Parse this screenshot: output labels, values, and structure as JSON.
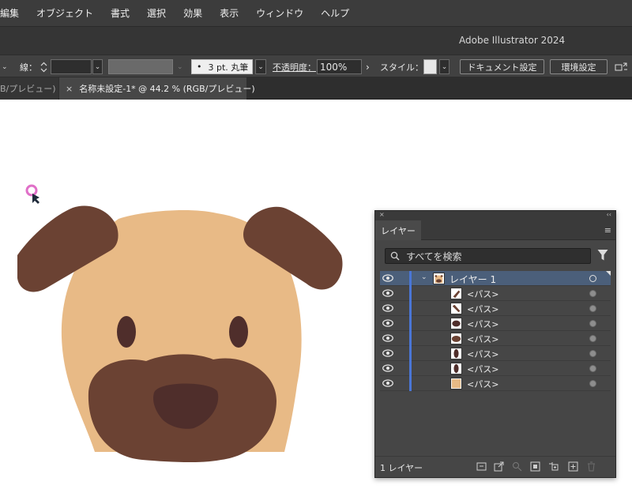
{
  "menubar": {
    "items": [
      "編集",
      "オブジェクト",
      "書式",
      "選択",
      "効果",
      "表示",
      "ウィンドウ",
      "ヘルプ"
    ]
  },
  "titlebar": {
    "title": "Adobe Illustrator 2024"
  },
  "controlbar": {
    "stroke_label": "線：",
    "brush_value": "3 pt. 丸筆",
    "brush_bullet": "•",
    "opacity_label": "不透明度：",
    "opacity_value": "100%",
    "style_label": "スタイル：",
    "doc_settings_button": "ドキュメント設定",
    "preferences_button": "環境設定",
    "chevron": "⌄"
  },
  "tabs": {
    "prev_tab_label": "B/プレビュー)",
    "active_tab_label": "名称未設定-1* @ 44.2 % (RGB/プレビュー)",
    "close_glyph": "×"
  },
  "artwork": {
    "face_color": "#E8BA86",
    "ear_color": "#6B4233",
    "muzzle_color": "#6B4233",
    "eye_color": "#4F2E2B",
    "nose_color": "#4F2E2B",
    "cursor_ring_color": "#E070C8"
  },
  "layers_panel": {
    "tab_label": "レイヤー",
    "close_glyph": "×",
    "collapse_glyph": "‹‹",
    "menu_glyph": "≡",
    "search_placeholder": "すべてを検索",
    "search_glyph": "🔍",
    "layer_name": "レイヤー 1",
    "expand_glyph": "⌄",
    "paths": [
      {
        "label": "<パス>",
        "thumb": "ear-right"
      },
      {
        "label": "<パス>",
        "thumb": "ear-left"
      },
      {
        "label": "<パス>",
        "thumb": "nose"
      },
      {
        "label": "<パス>",
        "thumb": "muzzle"
      },
      {
        "label": "<パス>",
        "thumb": "eye-right"
      },
      {
        "label": "<パス>",
        "thumb": "eye-left"
      },
      {
        "label": "<パス>",
        "thumb": "face"
      }
    ],
    "footer_count": "1 レイヤー",
    "accent_color": "#4A76D6"
  }
}
